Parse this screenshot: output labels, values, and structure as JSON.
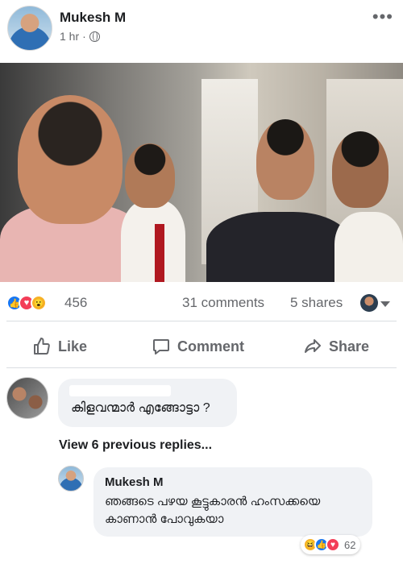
{
  "post": {
    "author": "Mukesh M",
    "time": "1 hr",
    "separator": "·",
    "more_icon": "more-horizontal-icon",
    "privacy_icon": "globe-icon"
  },
  "photo": {
    "description_icon": "photo"
  },
  "summary": {
    "reactions": [
      "like",
      "love",
      "wow"
    ],
    "reaction_count": "456",
    "comments": "31 comments",
    "shares": "5 shares"
  },
  "actions": {
    "like": "Like",
    "comment": "Comment",
    "share": "Share"
  },
  "comments": [
    {
      "text": "കിളവന്മാർ എങ്ങോട്ടാ ?",
      "view_replies": "View 6 previous replies..."
    }
  ],
  "reply": {
    "author": "Mukesh M",
    "text": "ഞങ്ങടെ പഴയ കൂട്ടുകാരൻ ഹംസക്കയെ കാണാൻ പോവുകയാ",
    "reactions": [
      "haha",
      "like",
      "love"
    ],
    "reaction_count": "62"
  },
  "colors": {
    "facebook_blue": "#1877f2",
    "love_red": "#f33e58",
    "wow_yellow": "#f7b125",
    "muted_text": "#65676b",
    "bubble_bg": "#f0f2f5"
  }
}
